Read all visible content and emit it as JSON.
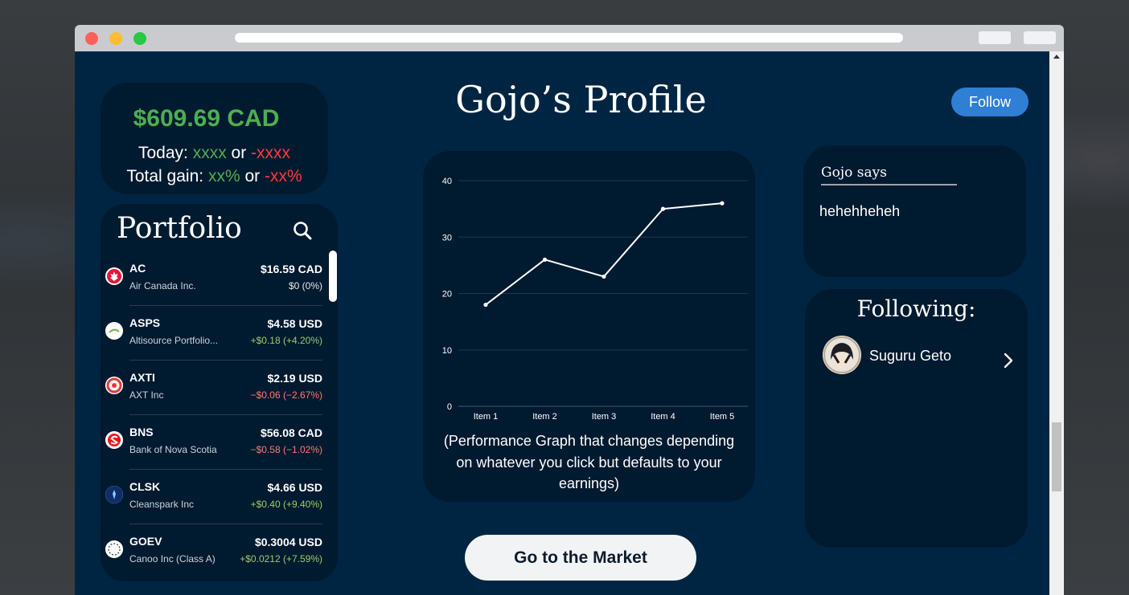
{
  "balance": {
    "amount": "$609.69 CAD",
    "today_label": "Today: ",
    "today_up": "xxxx",
    "today_or": " or ",
    "today_down": "-xxxx",
    "total_label": "Total gain: ",
    "total_up": "xx%",
    "total_or": " or ",
    "total_down": "-xx%"
  },
  "portfolio": {
    "title": "Portfolio",
    "items": [
      {
        "symbol": "AC",
        "name": "Air Canada Inc.",
        "price": "$16.59 CAD",
        "change": "$0 (0%)",
        "trend": "flat"
      },
      {
        "symbol": "ASPS",
        "name": "Altisource Portfolio...",
        "price": "$4.58 USD",
        "change": "+$0.18 (+4.20%)",
        "trend": "up"
      },
      {
        "symbol": "AXTI",
        "name": "AXT Inc",
        "price": "$2.19 USD",
        "change": "−$0.06 (−2.67%)",
        "trend": "down"
      },
      {
        "symbol": "BNS",
        "name": "Bank of Nova Scotia",
        "price": "$56.08 CAD",
        "change": "−$0.58 (−1.02%)",
        "trend": "down"
      },
      {
        "symbol": "CLSK",
        "name": "Cleanspark Inc",
        "price": "$4.66 USD",
        "change": "+$0.40 (+9.40%)",
        "trend": "up"
      },
      {
        "symbol": "GOEV",
        "name": "Canoo Inc (Class A)",
        "price": "$0.3004 USD",
        "change": "+$0.0212 (+7.59%)",
        "trend": "up"
      }
    ]
  },
  "header": {
    "title": "Gojo’s Profile",
    "follow_label": "Follow"
  },
  "chart_data": {
    "type": "line",
    "categories": [
      "Item 1",
      "Item 2",
      "Item 3",
      "Item 4",
      "Item 5"
    ],
    "values": [
      18,
      26,
      23,
      35,
      36
    ],
    "ylim": [
      0,
      40
    ],
    "yticks": [
      0,
      10,
      20,
      30,
      40
    ],
    "grid": true,
    "title": "",
    "xlabel": "",
    "ylabel": ""
  },
  "graph": {
    "caption": "(Performance Graph that changes depending on whatever you click but defaults to your earnings)"
  },
  "market": {
    "label": "Go to the Market"
  },
  "says": {
    "title": "Gojo says",
    "text": "hehehheheh"
  },
  "following": {
    "title": "Following:",
    "users": [
      {
        "name": "Suguru Geto"
      }
    ]
  },
  "colors": {
    "page_bg": "#002542",
    "card_bg": "#001a30",
    "positive": "#4caf50",
    "negative": "#ff3b3b",
    "follow_button": "#2f7fd4"
  },
  "icons": {
    "search": "search-icon",
    "chevron": "chevron-right-icon"
  }
}
